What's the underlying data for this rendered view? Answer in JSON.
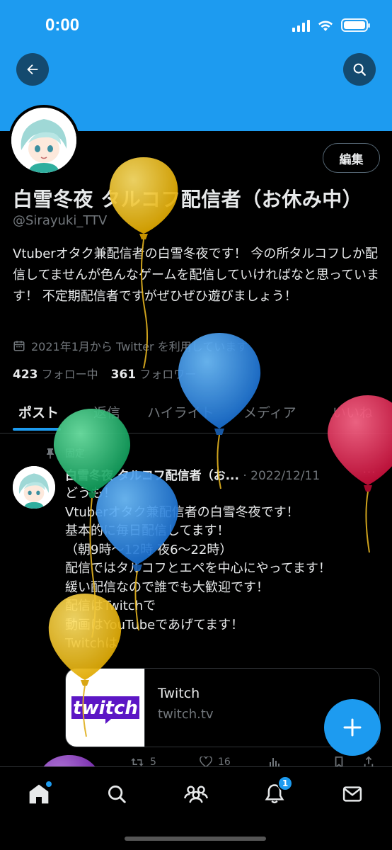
{
  "status_bar": {
    "time": "0:00"
  },
  "header": {
    "back_icon": "arrow-left-icon",
    "search_icon": "search-icon"
  },
  "profile": {
    "edit_label": "編集",
    "display_name": "白雪冬夜 タルコフ配信者（お休み中）",
    "handle": "@Sirayuki_TTV",
    "bio": "Vtuberオタク兼配信者の白雪冬夜です！ 今の所タルコフしか配信してませんが色んなゲームを配信していければなと思っています！ 不定期配信者ですがぜひぜひ遊びましょう！",
    "joined": "2021年1月から Twitter を利用しています",
    "following_count": "423",
    "following_label": "フォロー中",
    "followers_count": "361",
    "followers_label": "フォロワー"
  },
  "tabs": [
    {
      "label": "ポスト",
      "active": true
    },
    {
      "label": "返信",
      "active": false
    },
    {
      "label": "ハイライト",
      "active": false
    },
    {
      "label": "メディア",
      "active": false
    },
    {
      "label": "いいね",
      "active": false
    }
  ],
  "post": {
    "pinned_label": "固定",
    "author": "白雪冬夜 タルコフ配信者（お...",
    "date": "· 2022/12/11",
    "more": "···",
    "lines": [
      "どうも！",
      "Vtuberオタク兼配信者の白雪冬夜です！",
      "基本的に毎日配信してます！",
      "（朝9時〜12時 夜6〜22時）",
      "配信ではタルコフとエペを中心にやってます！",
      "緩い配信なので誰でも大歓迎です！",
      "配信はTwitchで",
      "動画はYouTubeであげてます！",
      "Twitchは"
    ],
    "card": {
      "thumb_text": "twitch",
      "title": "Twitch",
      "domain": "twitch.tv"
    },
    "retweets": "5",
    "likes": "16"
  },
  "fab_icon": "plus-icon",
  "bottom_nav": {
    "items": [
      "home-icon",
      "search-icon",
      "communities-icon",
      "bell-icon",
      "mail-icon"
    ],
    "notification_badge": "1"
  },
  "colors": {
    "accent": "#1d9bf0",
    "background": "#000000",
    "text": "#e7e9ea",
    "muted": "#71767b",
    "balloon_yellow": "#f2c21a",
    "balloon_blue": "#2a8ee6",
    "balloon_green": "#21c47a",
    "balloon_red": "#ee1c4b",
    "balloon_purple": "#9b3fd4",
    "twitch_purple": "#9146ff"
  }
}
